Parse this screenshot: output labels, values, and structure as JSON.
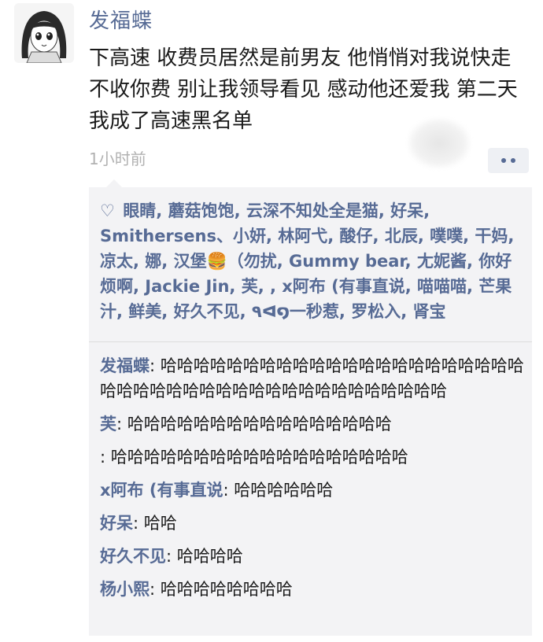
{
  "post": {
    "author": "发福蝶",
    "content": "下高速 收费员居然是前男友 他悄悄对我说快走 不收你费 别让我领导看见 感动他还爱我 第二天我成了高速黑名单",
    "time": "1小时前"
  },
  "likes": {
    "text": "眼睛, 蘑菇饱饱, 云深不知处全是猫, 好呆, Smithersens、小妍, 林阿弋, 酸仔, 北辰, 噗噗, 干妈, 凉太, 娜, 汉堡🍔（勿扰, Gummy bear, 尢妮酱, 你好烦啊, Jackie Jin, 芙, , x阿布 (有事直说, 喵喵喵, 芒果汁, 鲜美, 好久不见, ٩ᐊ໑一秒惹, 罗松入, 肾宝"
  },
  "comments": [
    {
      "name": "发福蝶",
      "text": ": 哈哈哈哈哈哈哈哈哈哈哈哈哈哈哈哈哈哈哈哈哈哈哈哈哈哈哈哈哈哈哈哈哈哈哈哈哈哈哈哈哈哈哈"
    },
    {
      "name": "芙",
      "text": ": 哈哈哈哈哈哈哈哈哈哈哈哈哈哈哈哈"
    },
    {
      "name": "",
      "text": ": 哈哈哈哈哈哈哈哈哈哈哈哈哈哈哈哈哈哈"
    },
    {
      "name": "x阿布 (有事直说",
      "text": ": 哈哈哈哈哈哈"
    },
    {
      "name": "好呆",
      "text": ": 哈哈"
    },
    {
      "name": "好久不见",
      "text": ": 哈哈哈哈"
    },
    {
      "name": "杨小熙",
      "text": ": 哈哈哈哈哈哈哈哈"
    }
  ],
  "icons": {
    "like": "heart-outline-icon",
    "more": "ellipsis-icon"
  },
  "colors": {
    "link": "#576b95",
    "time": "#b2b2b2",
    "panel": "#f3f3f5"
  }
}
